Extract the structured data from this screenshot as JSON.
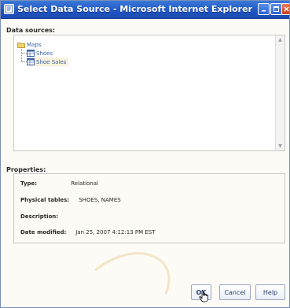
{
  "window": {
    "title": "Select Data Source - Microsoft Internet Explorer"
  },
  "data_sources": {
    "label": "Data sources:",
    "tree": [
      {
        "label": "Maps",
        "icon": "folder-icon"
      },
      {
        "label": "Shoes",
        "icon": "table-icon"
      },
      {
        "label": "Shoe Sales",
        "icon": "table-icon",
        "selected": true
      }
    ]
  },
  "properties": {
    "label": "Properties:",
    "rows": [
      {
        "key": "Type:",
        "value": "Relational"
      },
      {
        "key": "Physical tables:",
        "value": "SHOES, NAMES"
      },
      {
        "key": "Description:",
        "value": ""
      },
      {
        "key": "Date modified:",
        "value": "Jan 25, 2007 4:12:13 PM EST"
      }
    ]
  },
  "buttons": {
    "ok": "OK",
    "cancel": "Cancel",
    "help": "Help"
  },
  "colors": {
    "titlebar": "#1f55c4",
    "accent_link": "#3a63a8",
    "selection": "#f9f1dc"
  }
}
